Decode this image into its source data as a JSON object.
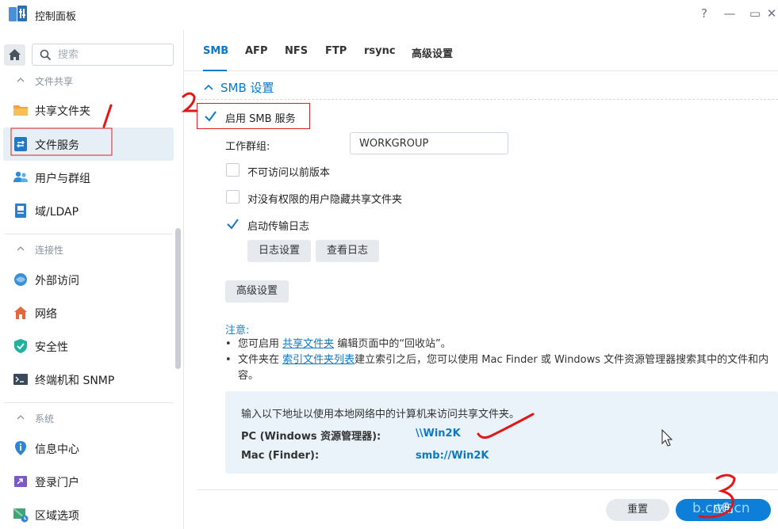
{
  "window": {
    "title": "控制面板",
    "controls": [
      "?",
      "—",
      "▭",
      "✕"
    ]
  },
  "sidebar": {
    "search_placeholder": "搜索",
    "sections": [
      {
        "label": "文件共享",
        "items": [
          {
            "label": "共享文件夹",
            "icon": "shared-folder-icon"
          },
          {
            "label": "文件服务",
            "icon": "file-services-icon",
            "active": true
          },
          {
            "label": "用户与群组",
            "icon": "user-group-icon"
          },
          {
            "label": "域/LDAP",
            "icon": "domain-ldap-icon"
          }
        ]
      },
      {
        "label": "连接性",
        "items": [
          {
            "label": "外部访问",
            "icon": "external-access-icon"
          },
          {
            "label": "网络",
            "icon": "network-icon"
          },
          {
            "label": "安全性",
            "icon": "security-shield-icon"
          },
          {
            "label": "终端机和 SNMP",
            "icon": "terminal-icon"
          }
        ]
      },
      {
        "label": "系统",
        "items": [
          {
            "label": "信息中心",
            "icon": "info-center-icon"
          },
          {
            "label": "登录门户",
            "icon": "login-portal-icon"
          },
          {
            "label": "区域选项",
            "icon": "regional-options-icon"
          }
        ]
      }
    ]
  },
  "tabs": [
    "SMB",
    "AFP",
    "NFS",
    "FTP",
    "rsync",
    "高级设置"
  ],
  "content": {
    "section_title": "SMB 设置",
    "enable_smb": {
      "label": "启用 SMB 服务",
      "checked": true
    },
    "workgroup": {
      "label": "工作群组:",
      "value": "WORKGROUP"
    },
    "prev_versions": {
      "label": "不可访问以前版本",
      "checked": false
    },
    "hide_shares": {
      "label": "对没有权限的用户隐藏共享文件夹",
      "checked": false
    },
    "transfer_log": {
      "label": "启动传输日志",
      "checked": true
    },
    "log_settings_btn": "日志设置",
    "view_log_btn": "查看日志",
    "advanced_btn": "高级设置",
    "note": {
      "title": "注意:",
      "line1_prefix": "您可启用",
      "line1_link": "共享文件夹",
      "line1_suffix": "编辑页面中的“回收站”。",
      "line2_prefix": "文件夹在",
      "line2_link": "索引文件夹列表",
      "line2_suffix": "建立索引之后，您可以使用 Mac Finder 或 Windows 文件资源管理器搜索其中的文件和内容。"
    },
    "access_info": {
      "intro": "输入以下地址以使用本地网络中的计算机来访问共享文件夹。",
      "pc_label": "PC (Windows 资源管理器):",
      "pc_value": "\\\\Win2K",
      "mac_label": "Mac (Finder):",
      "mac_value": "smb://Win2K"
    }
  },
  "footer": {
    "reset": "重置",
    "apply": "应用"
  },
  "annotations": {
    "marks": [
      "1",
      "2",
      "3"
    ],
    "watermark": "b.cn6.cn"
  }
}
